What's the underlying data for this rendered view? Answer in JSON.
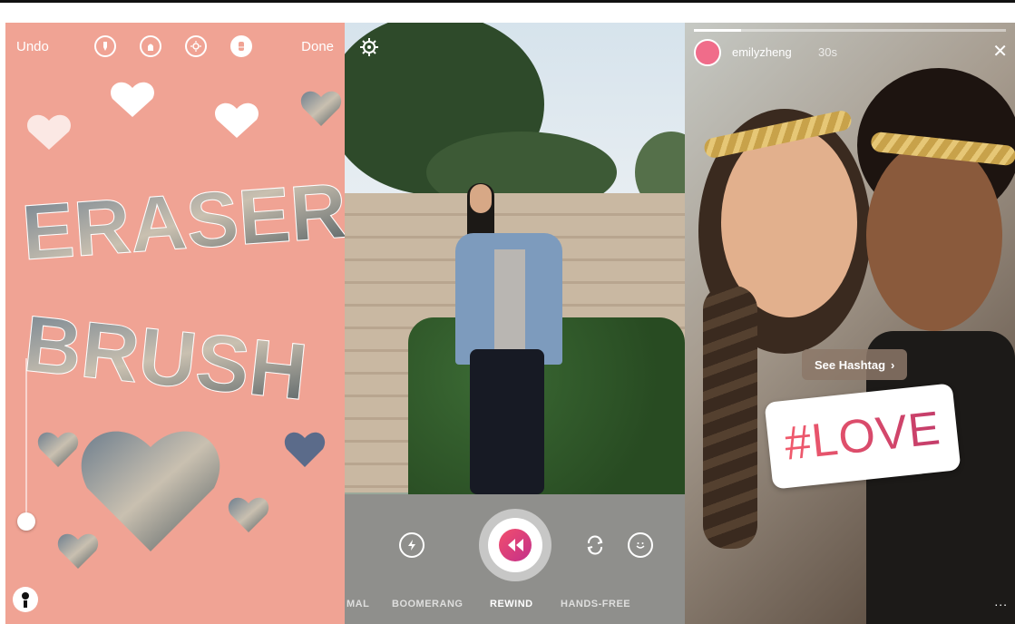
{
  "panel1": {
    "undo_label": "Undo",
    "done_label": "Done",
    "tools": [
      {
        "icon": "marker-pen-icon",
        "active": false
      },
      {
        "icon": "brush-icon",
        "active": false
      },
      {
        "icon": "neon-pen-icon",
        "active": false
      },
      {
        "icon": "eraser-icon",
        "active": true
      }
    ],
    "canvas_words": [
      "ERASER",
      "BRUSH"
    ],
    "slider_level": 0.06,
    "background_color": "#f0a394"
  },
  "panel2": {
    "modes": [
      "MAL",
      "BOOMERANG",
      "REWIND",
      "HANDS-FREE"
    ],
    "active_mode": "REWIND",
    "icons": [
      "settings-gear-icon",
      "flash-icon",
      "rewind-icon",
      "flip-camera-icon",
      "face-filter-icon"
    ]
  },
  "panel3": {
    "username": "emilyzheng",
    "time_ago": "30s",
    "see_hashtag_label": "See Hashtag",
    "hashtag_sticker": "#LOVE",
    "progress": 0.15,
    "more_label": "..."
  }
}
